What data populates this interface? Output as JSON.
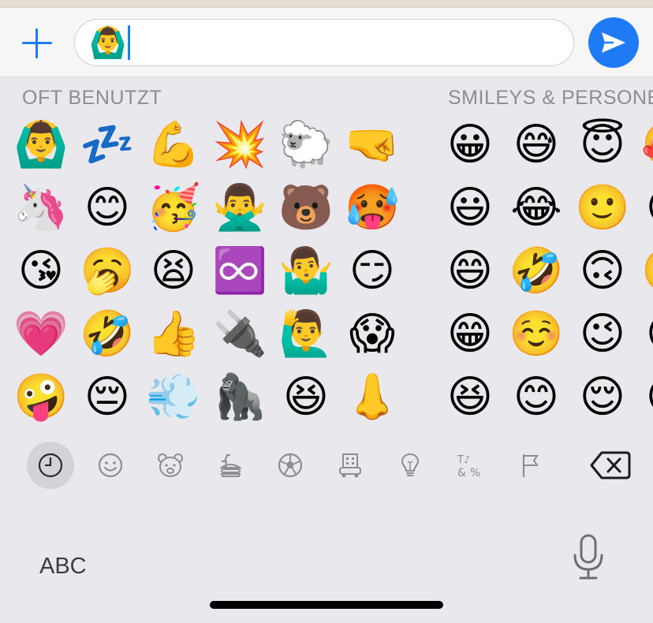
{
  "input": {
    "current_value": "🙆‍♂️",
    "send_label": "Send"
  },
  "sections": {
    "frequently_used": {
      "title": "OFT BENUTZT",
      "emojis": [
        "🙆‍♂️",
        "🦄",
        "😘",
        "💗",
        "🤪",
        "💤",
        "😊",
        "🥱",
        "🤣",
        "😔",
        "💪",
        "🥳",
        "😫",
        "👍",
        "💨",
        "💥",
        "🙅‍♂️",
        "♾️",
        "🔌",
        "🦍",
        "🐑",
        "🐻",
        "🤷‍♂️",
        "🙋‍♂️",
        "😆",
        "🤜",
        "🥵",
        "😏",
        "😱",
        "👃"
      ]
    },
    "smileys": {
      "title": "SMILEYS & PERSONEN",
      "emojis": [
        "😀",
        "😃",
        "😄",
        "😁",
        "😆",
        "😅",
        "😂",
        "🤣",
        "☺️",
        "😊",
        "😇",
        "🙂",
        "🙃",
        "😉",
        "😌",
        "🥰",
        "😍",
        "🥲",
        "😋",
        "😛"
      ]
    }
  },
  "categories": [
    "clock-icon",
    "smiley-icon",
    "bear-icon",
    "food-icon",
    "ball-icon",
    "buildings-icon",
    "bulb-icon",
    "symbols-icon",
    "flag-icon"
  ],
  "keyboard": {
    "abc_label": "ABC"
  },
  "colors": {
    "accent": "#1f7bf5",
    "keyboard_bg": "#e9e8ec",
    "section_title": "#8e8d92"
  }
}
